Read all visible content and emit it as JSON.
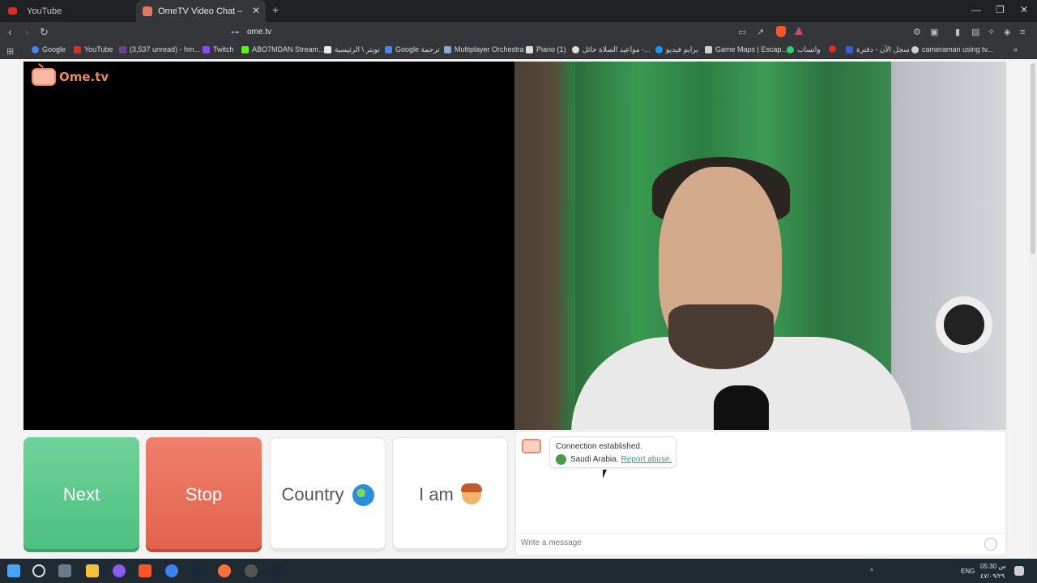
{
  "tabs": [
    {
      "title": "YouTube"
    },
    {
      "title": "OmeTV Video Chat — Omegle"
    }
  ],
  "address": "ome.tv",
  "bookmarks": [
    "Google",
    "YouTube",
    "(3,537 unread) - hm...",
    "Twitch",
    "ABO7MDAN Stream...",
    "تويتر \\ الرئيسية",
    "Google ترجمة",
    "Multiplayer Orchestra",
    "Piano (1)",
    "مواعيد الصلاة حائل -...",
    "برايم فيديو",
    "Game Maps | Escap...",
    "واتساب",
    "سجل الآن - دفترة",
    "cameraman using tv..."
  ],
  "logo_text": "Ome.tv",
  "buttons": {
    "next": "Next",
    "stop": "Stop",
    "country": "Country",
    "iam": "I am"
  },
  "chat": {
    "status": "Connection established.",
    "country": "Saudi Arabia.",
    "report": "Report abuse.",
    "placeholder": "Write a message"
  },
  "taskbar": {
    "lang": "ENG",
    "time": "05:30 ص",
    "date": "٤٧/٠٩/٢٩"
  }
}
